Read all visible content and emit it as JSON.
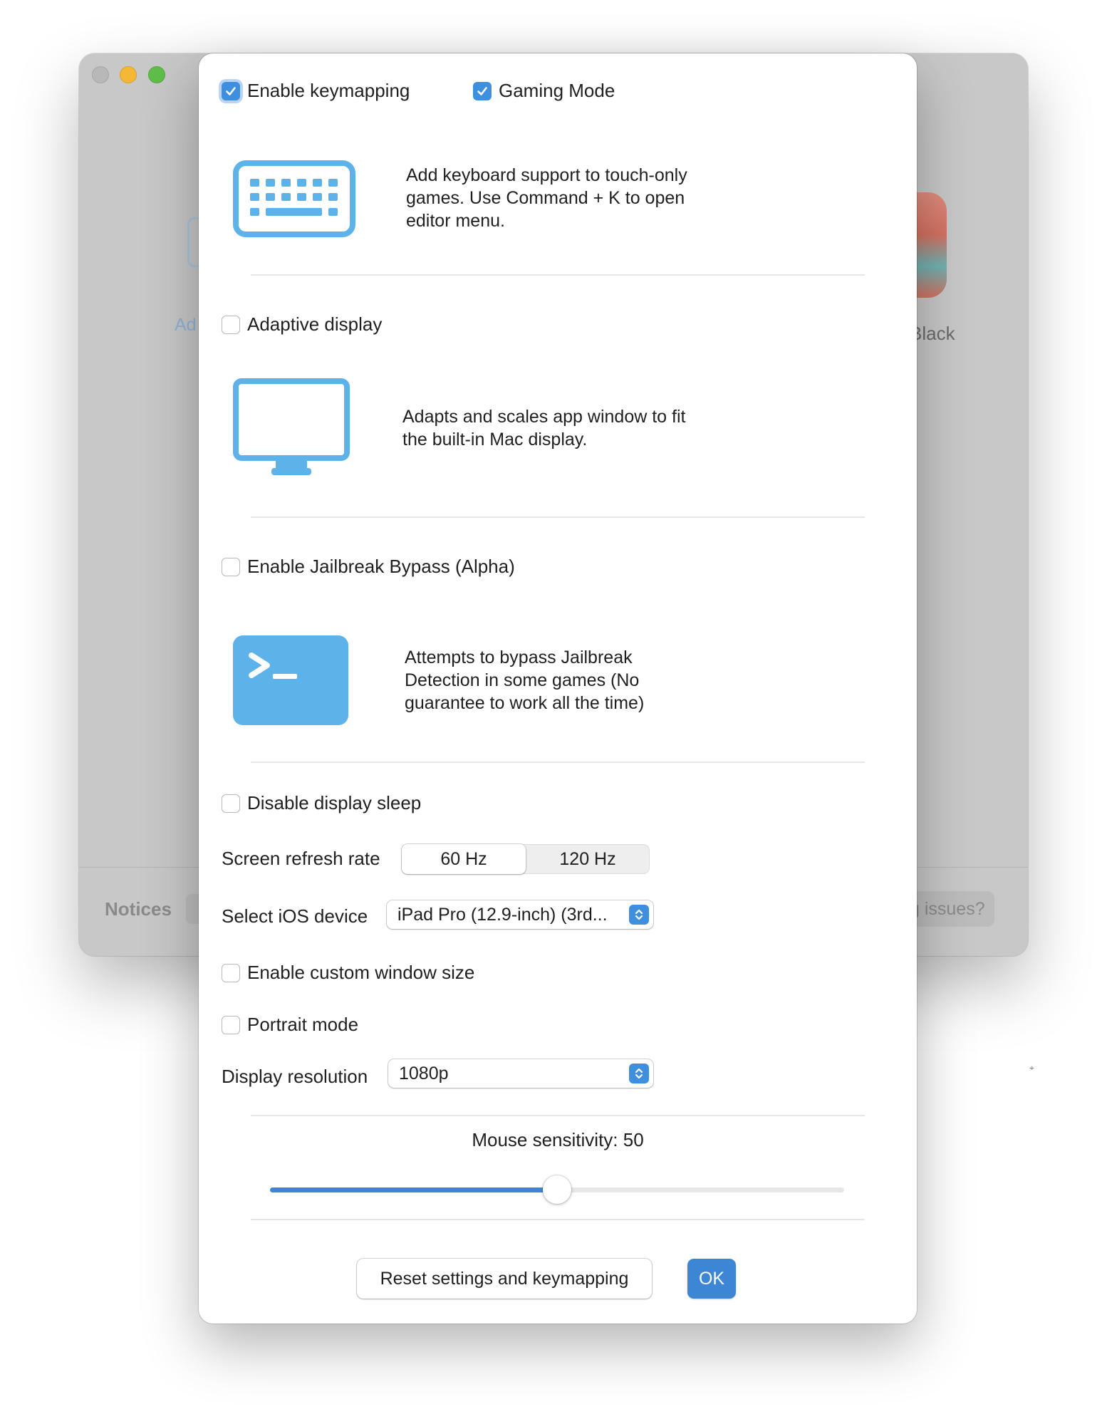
{
  "background_window": {
    "left_app_label": "Ad",
    "right_app_label": "Black",
    "footer_left": "Notices",
    "footer_right": "g issues?"
  },
  "settings": {
    "enable_keymapping": {
      "label": "Enable keymapping",
      "checked": true
    },
    "gaming_mode": {
      "label": "Gaming Mode",
      "checked": true
    },
    "keymapping_description": "Add keyboard support to touch-only games. Use Command + K to open editor menu.",
    "keymapping_icon": "keyboard-icon",
    "adaptive_display": {
      "label": "Adaptive display",
      "checked": false
    },
    "adaptive_description": "Adapts and scales app window to fit the built-in Mac display.",
    "adaptive_icon": "monitor-icon",
    "jailbreak_bypass": {
      "label": "Enable Jailbreak Bypass (Alpha)",
      "checked": false
    },
    "jailbreak_description": "Attempts to bypass Jailbreak Detection in some games (No guarantee to work all the time)",
    "jailbreak_icon": "terminal-icon",
    "disable_display_sleep": {
      "label": "Disable display sleep",
      "checked": false
    },
    "refresh_rate": {
      "label": "Screen refresh rate",
      "options": [
        "60 Hz",
        "120 Hz"
      ],
      "selected": "60 Hz"
    },
    "ios_device": {
      "label": "Select iOS device",
      "value": "iPad Pro (12.9-inch) (3rd..."
    },
    "custom_window_size": {
      "label": "Enable custom window size",
      "checked": false
    },
    "portrait_mode": {
      "label": "Portrait mode",
      "checked": false
    },
    "display_resolution": {
      "label": "Display resolution",
      "value": "1080p"
    },
    "mouse_sensitivity": {
      "label": "Mouse sensitivity: 50",
      "value": 50,
      "min": 0,
      "max": 100
    }
  },
  "buttons": {
    "reset": "Reset settings and keymapping",
    "ok": "OK"
  },
  "colors": {
    "accent": "#3d86d6",
    "icon_blue": "#5eb2ea"
  }
}
